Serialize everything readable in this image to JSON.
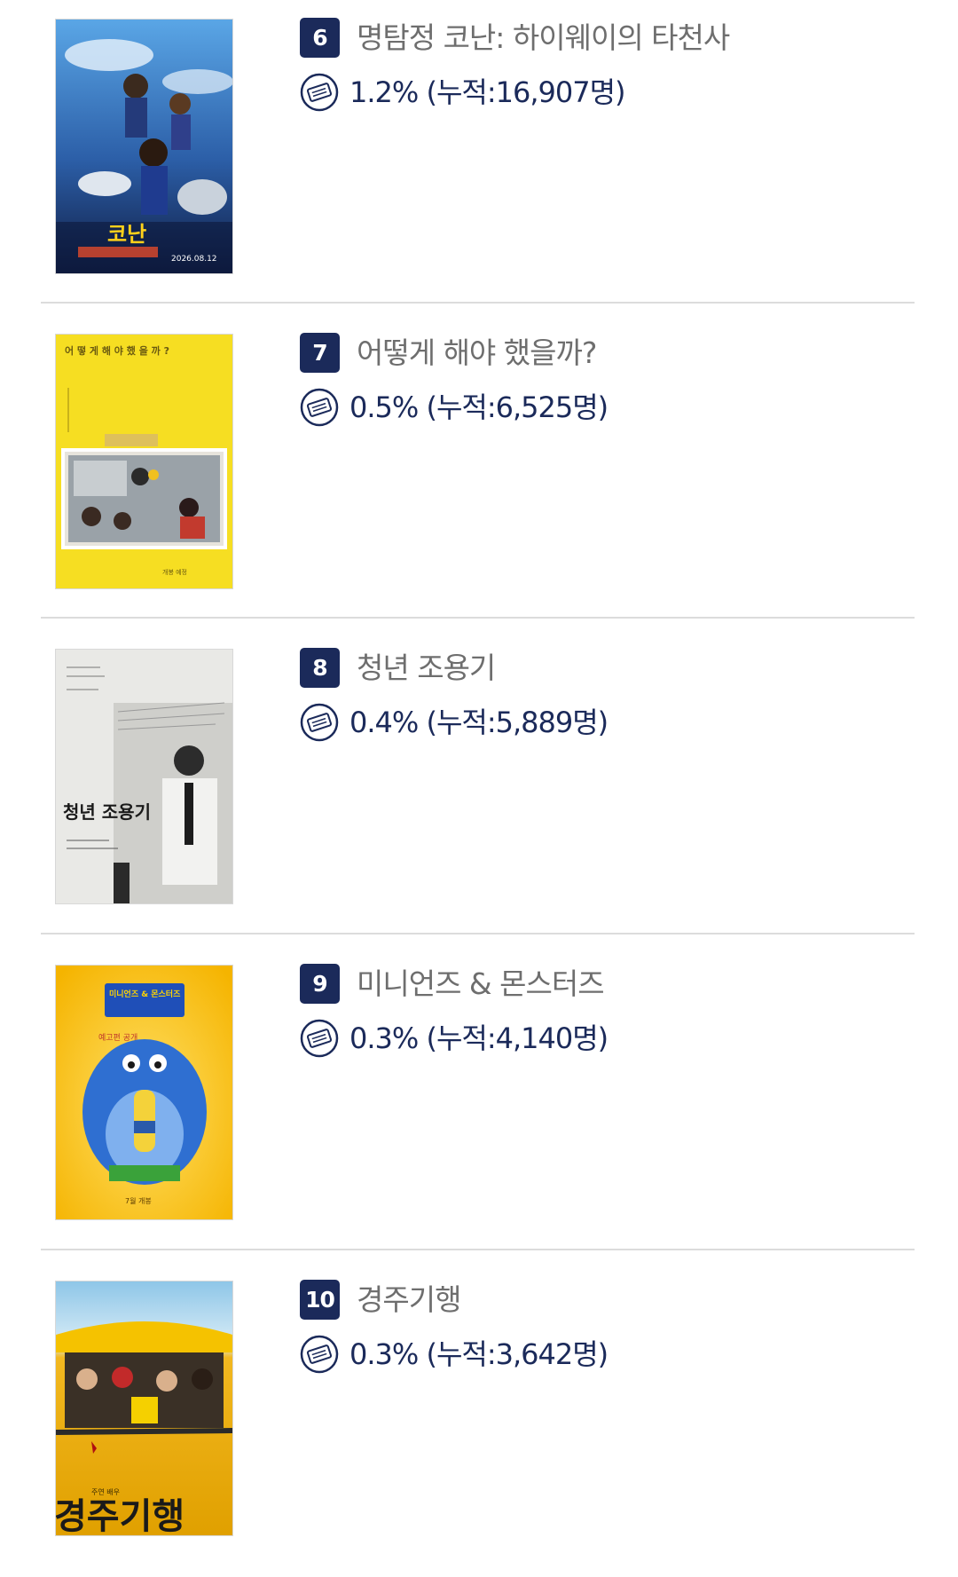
{
  "ranking": {
    "items": [
      {
        "rank": "6",
        "title": "명탐정 코난: 하이웨이의 타천사",
        "stat": "1.2% (누적:16,907명)",
        "poster_icon": "anime-poster",
        "poster_text": "코난"
      },
      {
        "rank": "7",
        "title": "어떻게 해야 했을까?",
        "stat": "0.5% (누적:6,525명)",
        "poster_icon": "yellow-photo-poster",
        "poster_text": "어 떻 게 해 야 했 을 까 ?"
      },
      {
        "rank": "8",
        "title": "청년 조용기",
        "stat": "0.4% (누적:5,889명)",
        "poster_icon": "bw-portrait-poster",
        "poster_text": "청년 조용기"
      },
      {
        "rank": "9",
        "title": "미니언즈 & 몬스터즈",
        "stat": "0.3% (누적:4,140명)",
        "poster_icon": "minions-poster",
        "poster_text": "미니언즈 & 몬스터즈"
      },
      {
        "rank": "10",
        "title": "경주기행",
        "stat": "0.3% (누적:3,642명)",
        "poster_icon": "car-poster",
        "poster_text": "경주기행"
      }
    ]
  },
  "colors": {
    "badge": "#1b2a5a",
    "title": "#6e6e6e",
    "stat": "#1b2a5a",
    "divider": "#dcdcdc"
  },
  "icons": {
    "ticket": "ticket-icon"
  }
}
